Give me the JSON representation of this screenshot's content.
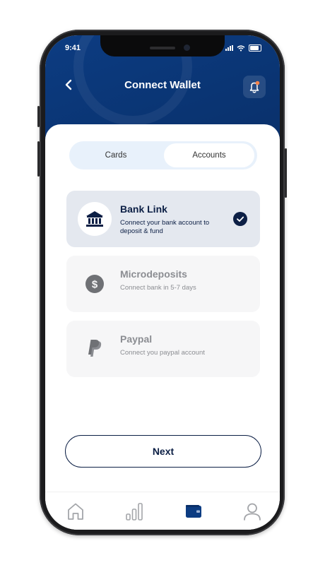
{
  "status_bar": {
    "time": "9:41"
  },
  "header": {
    "title": "Connect Wallet"
  },
  "segmented": {
    "tabs": [
      "Cards",
      "Accounts"
    ],
    "active": "Accounts"
  },
  "options": [
    {
      "name": "Bank Link",
      "description": "Connect your bank account to deposit & fund",
      "icon": "bank-icon",
      "selected": true
    },
    {
      "name": "Microdeposits",
      "description": "Connect bank in 5-7 days",
      "icon": "dollar-icon",
      "selected": false
    },
    {
      "name": "Paypal",
      "description": "Connect you paypal account",
      "icon": "paypal-icon",
      "selected": false
    }
  ],
  "next_button": {
    "label": "Next"
  },
  "tab_bar": {
    "items": [
      "home-icon",
      "stats-icon",
      "wallet-icon",
      "profile-icon"
    ],
    "active": "wallet-icon"
  },
  "colors": {
    "header_bg": "#0c3c82",
    "primary": "#0c1f45",
    "notification_dot": "#f5824a",
    "segment_bg": "#e8f1fb"
  }
}
